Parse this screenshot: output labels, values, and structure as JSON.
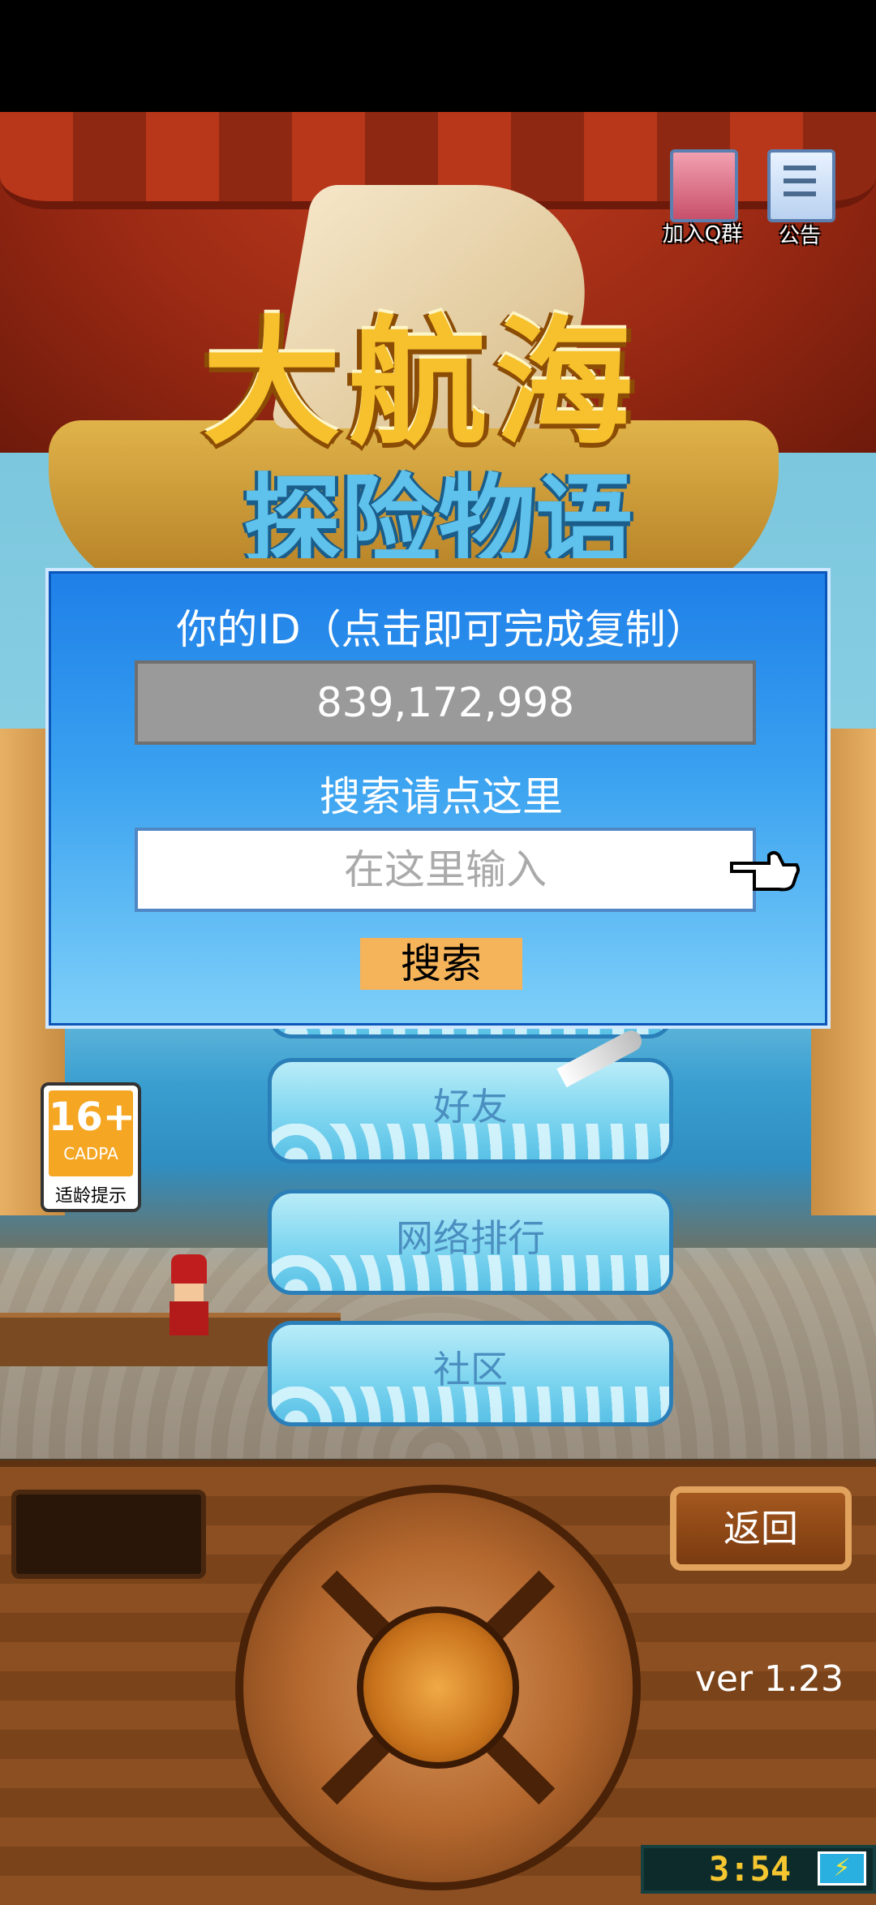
{
  "top_icons": {
    "qq_group_label": "加入Q群",
    "announcement_label": "公告"
  },
  "logo": {
    "title": "大航海",
    "subtitle": "探险物语"
  },
  "dialog": {
    "id_label": "你的ID（点击即可完成复制）",
    "id_value": "839,172,998",
    "search_label": "搜索请点这里",
    "input_placeholder": "在这里输入",
    "search_button": "搜索"
  },
  "menu": {
    "friends": "好友",
    "ranking": "网络排行",
    "community": "社区"
  },
  "age_rating": {
    "age": "16+",
    "org": "CADPA",
    "note": "适龄提示"
  },
  "console": {
    "back_button": "返回",
    "version": "ver 1.23",
    "time": "3:54",
    "battery_icon": "⚡"
  },
  "colors": {
    "dialog_blue": "#1e7fe8",
    "search_button": "#f5b35a",
    "clock_text": "#f5c630"
  }
}
